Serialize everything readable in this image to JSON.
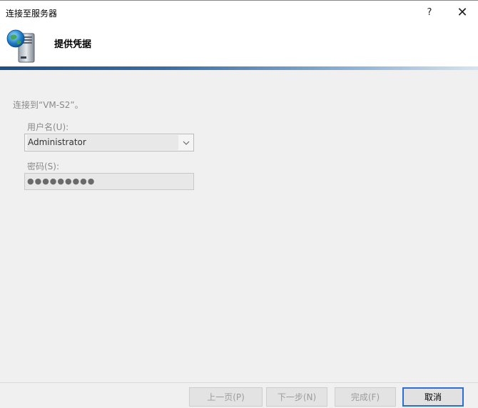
{
  "window": {
    "title": "连接至服务器"
  },
  "titlebar": {
    "help_label": "?",
    "close_label": "✕"
  },
  "header": {
    "title": "提供凭据",
    "icon": "server-globe-icon"
  },
  "form": {
    "connect_text": "连接到“VM-S2”。",
    "username_label": "用户名(U):",
    "username_value": "Administrator",
    "password_label": "密码(S):",
    "password_value": "●●●●●●●●●"
  },
  "footer": {
    "prev_label": "上一页(P)",
    "next_label": "下一步(N)",
    "finish_label": "完成(F)",
    "cancel_label": "取消"
  },
  "colors": {
    "header_bar_start": "#1b4f86",
    "cancel_border": "#2b6fd6"
  }
}
